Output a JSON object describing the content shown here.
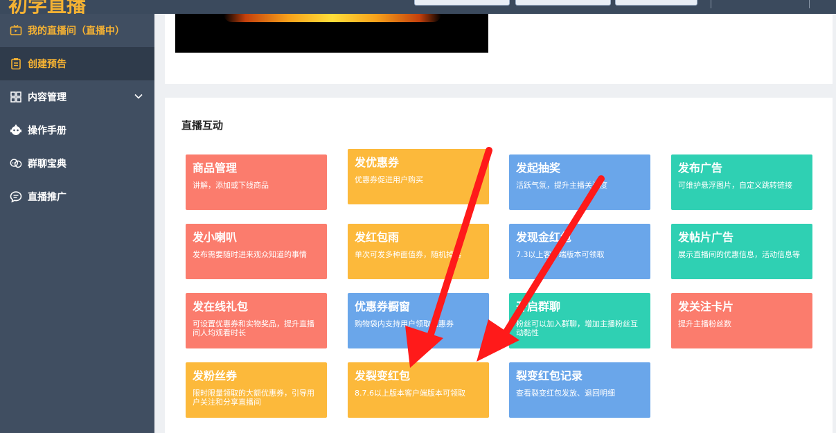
{
  "topbar": {
    "logo_text": "初学直播"
  },
  "sidebar": {
    "items": [
      {
        "label": "我的直播间（直播中）",
        "icon": "tv-icon"
      },
      {
        "label": "创建预告",
        "icon": "clipboard-icon"
      },
      {
        "label": "内容管理",
        "icon": "grid-icon"
      },
      {
        "label": "操作手册",
        "icon": "robot-icon"
      },
      {
        "label": "群聊宝典",
        "icon": "chat-bubbles-icon"
      },
      {
        "label": "直播推广",
        "icon": "speech-icon"
      }
    ]
  },
  "section": {
    "title": "直播互动"
  },
  "tiles": [
    {
      "title": "商品管理",
      "desc": "讲解，添加或下线商品",
      "color": "#fb7c6d"
    },
    {
      "title": "发优惠券",
      "desc": "优惠券促进用户购买",
      "color": "#fcb93b"
    },
    {
      "title": "发起抽奖",
      "desc": "活跃气氛，提升主播关注度",
      "color": "#6aa6ea"
    },
    {
      "title": "发布广告",
      "desc": "可维护悬浮图片，自定义跳转链接",
      "color": "#2fd0b3"
    },
    {
      "title": "发小喇叭",
      "desc": "发布需要随时进来观众知道的事情",
      "color": "#fb7c6d"
    },
    {
      "title": "发红包雨",
      "desc": "单次可发多种面值券，随机掉落",
      "color": "#fcb93b"
    },
    {
      "title": "发现金红包",
      "desc": "7.3以上客户端版本可领取",
      "color": "#6aa6ea"
    },
    {
      "title": "发帖片广告",
      "desc": "展示直播间的优惠信息，活动信息等",
      "color": "#2fd0b3"
    },
    {
      "title": "发在线礼包",
      "desc": "可设置优惠券和实物奖品，提升直播间人均观看时长",
      "color": "#fb7c6d"
    },
    {
      "title": "优惠券橱窗",
      "desc": "购物袋内支持用户领取优惠券",
      "color": "#6aa6ea"
    },
    {
      "title": "开启群聊",
      "desc": "粉丝可以加入群聊，增加主播粉丝互动黏性",
      "color": "#2fd0b3"
    },
    {
      "title": "发关注卡片",
      "desc": "提升主播粉丝数",
      "color": "#fb7c6d"
    },
    {
      "title": "发粉丝券",
      "desc": "限时限量领取的大额优惠券，引导用户关注和分享直播间",
      "color": "#fcb93b"
    },
    {
      "title": "发裂变红包",
      "desc": "8.7.6以上版本客户端版本可领取",
      "color": "#fcb93b"
    },
    {
      "title": "裂变红包记录",
      "desc": "查看裂变红包发放、退回明细",
      "color": "#6aa6ea"
    }
  ],
  "annotation": {
    "arrow_color": "#ff1a1a"
  }
}
